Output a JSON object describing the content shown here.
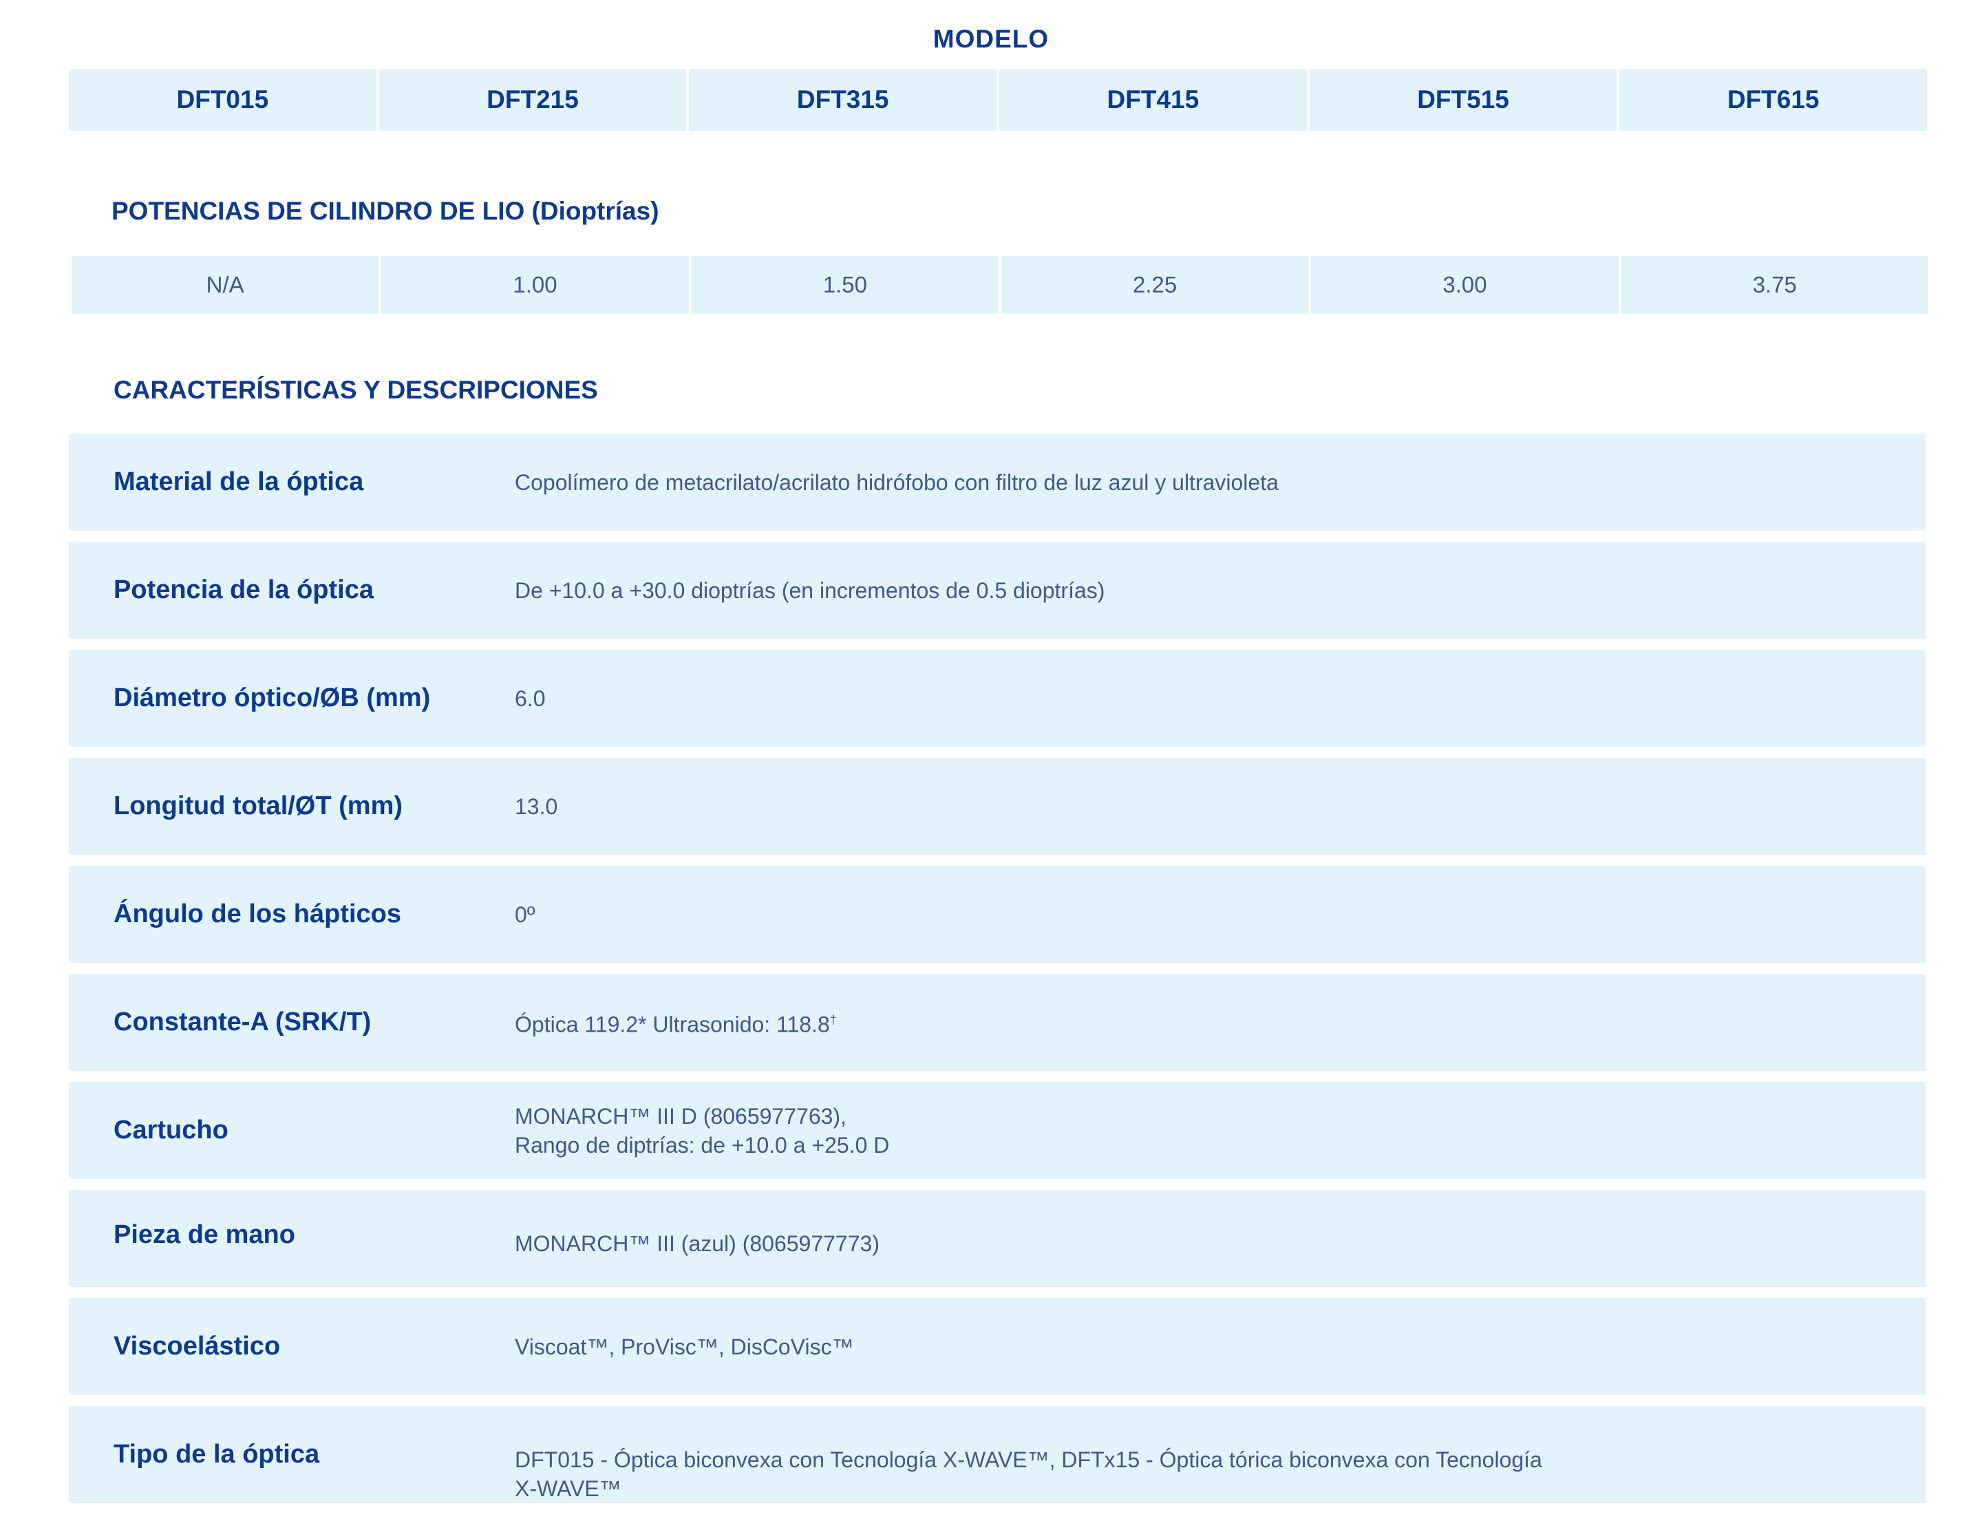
{
  "modelo": {
    "title": "MODELO",
    "models": [
      "DFT015",
      "DFT215",
      "DFT315",
      "DFT415",
      "DFT515",
      "DFT615"
    ]
  },
  "cilindro": {
    "title": "POTENCIAS DE CILINDRO DE LIO (Dioptrías)",
    "values": [
      "N/A",
      "1.00",
      "1.50",
      "2.25",
      "3.00",
      "3.75"
    ]
  },
  "caracteristicas": {
    "title": "CARACTERÍSTICAS Y DESCRIPCIONES",
    "rows": [
      {
        "label": "Material de la óptica",
        "lines": [
          "Copolímero de metacrilato/acrilato hidrófobo con filtro de luz azul y ultravioleta"
        ]
      },
      {
        "label": "Potencia de la óptica",
        "lines": [
          "De +10.0 a +30.0 dioptrías (en incrementos de 0.5 dioptrías)"
        ]
      },
      {
        "label": "Diámetro óptico/ØB (mm)",
        "lines": [
          "6.0"
        ]
      },
      {
        "label": "Longitud total/ØT (mm)",
        "lines": [
          "13.0"
        ]
      },
      {
        "label": "Ángulo de los hápticos",
        "lines": [
          "0º"
        ]
      },
      {
        "label": "Constante-A (SRK/T)",
        "lines": [
          "Óptica 119.2* Ultrasonido: 118.8"
        ],
        "sup": "†"
      },
      {
        "label": "Cartucho",
        "lines": [
          "MONARCH™ III D (8065977763),",
          "Rango de diptrías: de +10.0 a +25.0 D"
        ]
      },
      {
        "label": "Pieza de mano",
        "lines": [
          "MONARCH™ III (azul) (8065977773)"
        ]
      },
      {
        "label": "Viscoelástico",
        "lines": [
          "Viscoat™, ProVisc™, DisCoVisc™"
        ]
      },
      {
        "label": "Tipo de la óptica",
        "lines": [
          "DFT015 - Óptica biconvexa con Tecnología X-WAVE™, DFTx15 - Óptica tórica biconvexa con Tecnología",
          "X-WAVE™"
        ]
      }
    ]
  }
}
